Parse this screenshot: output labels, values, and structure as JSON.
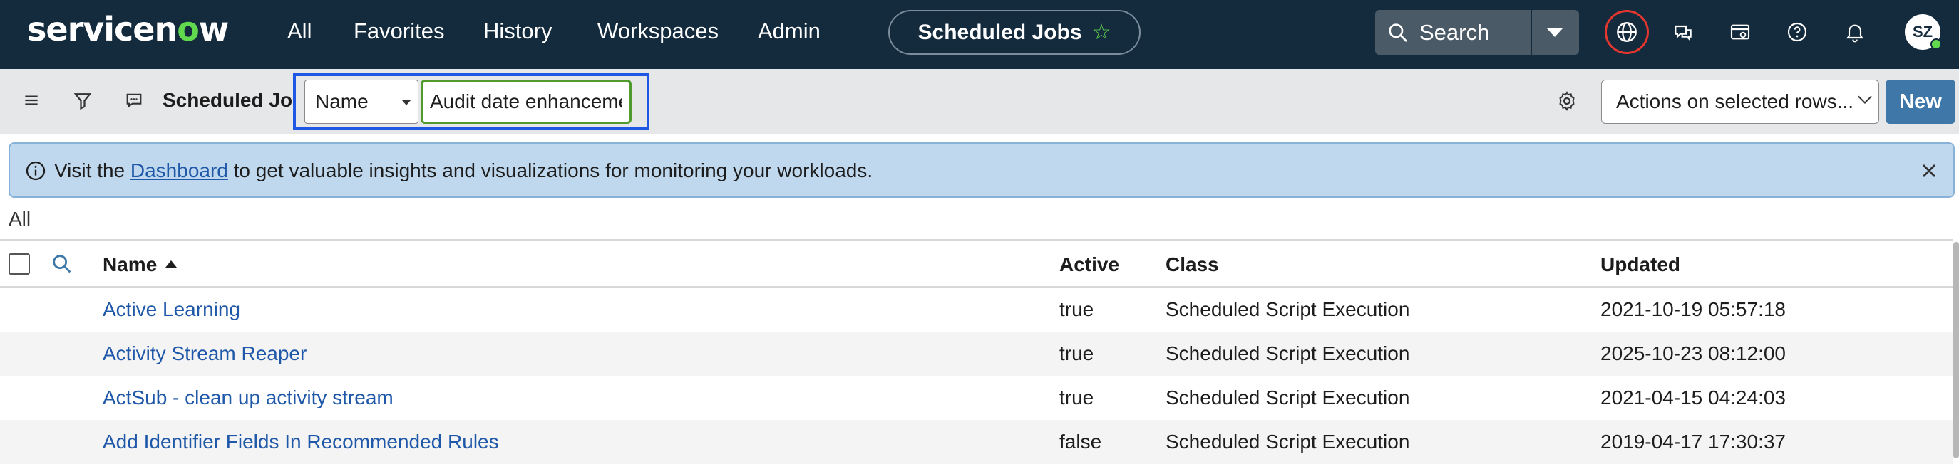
{
  "brand": {
    "logo_prefix": "servicen",
    "logo_o": "o",
    "logo_suffix": "w"
  },
  "nav": {
    "items": [
      "All",
      "Favorites",
      "History",
      "Workspaces",
      "Admin"
    ],
    "context_title": "Scheduled Jobs",
    "search_label": "Search",
    "user_initials": "SZ"
  },
  "toolbar": {
    "list_title": "Scheduled Jobs",
    "field_select": "Name",
    "search_value": "Audit date enhanceme",
    "actions_label": "Actions on selected rows...",
    "new_label": "New"
  },
  "banner": {
    "prefix": "Visit the ",
    "link": "Dashboard",
    "suffix": " to get valuable insights and visualizations for monitoring your workloads."
  },
  "breadcrumb": "All",
  "table": {
    "columns": {
      "name": "Name",
      "active": "Active",
      "class": "Class",
      "updated": "Updated"
    },
    "rows": [
      {
        "name": "Active Learning",
        "active": "true",
        "class": "Scheduled Script Execution",
        "updated": "2021-10-19 05:57:18"
      },
      {
        "name": "Activity Stream Reaper",
        "active": "true",
        "class": "Scheduled Script Execution",
        "updated": "2025-10-23 08:12:00"
      },
      {
        "name": "ActSub - clean up activity stream",
        "active": "true",
        "class": "Scheduled Script Execution",
        "updated": "2021-04-15 04:24:03"
      },
      {
        "name": "Add Identifier Fields In Recommended Rules",
        "active": "false",
        "class": "Scheduled Script Execution",
        "updated": "2019-04-17 17:30:37"
      }
    ]
  },
  "colors": {
    "nav_bg": "#142b3e",
    "accent_green": "#62d84e",
    "new_button": "#3f78a8",
    "link": "#1f58a8",
    "highlight_frame": "#1f57e5"
  }
}
